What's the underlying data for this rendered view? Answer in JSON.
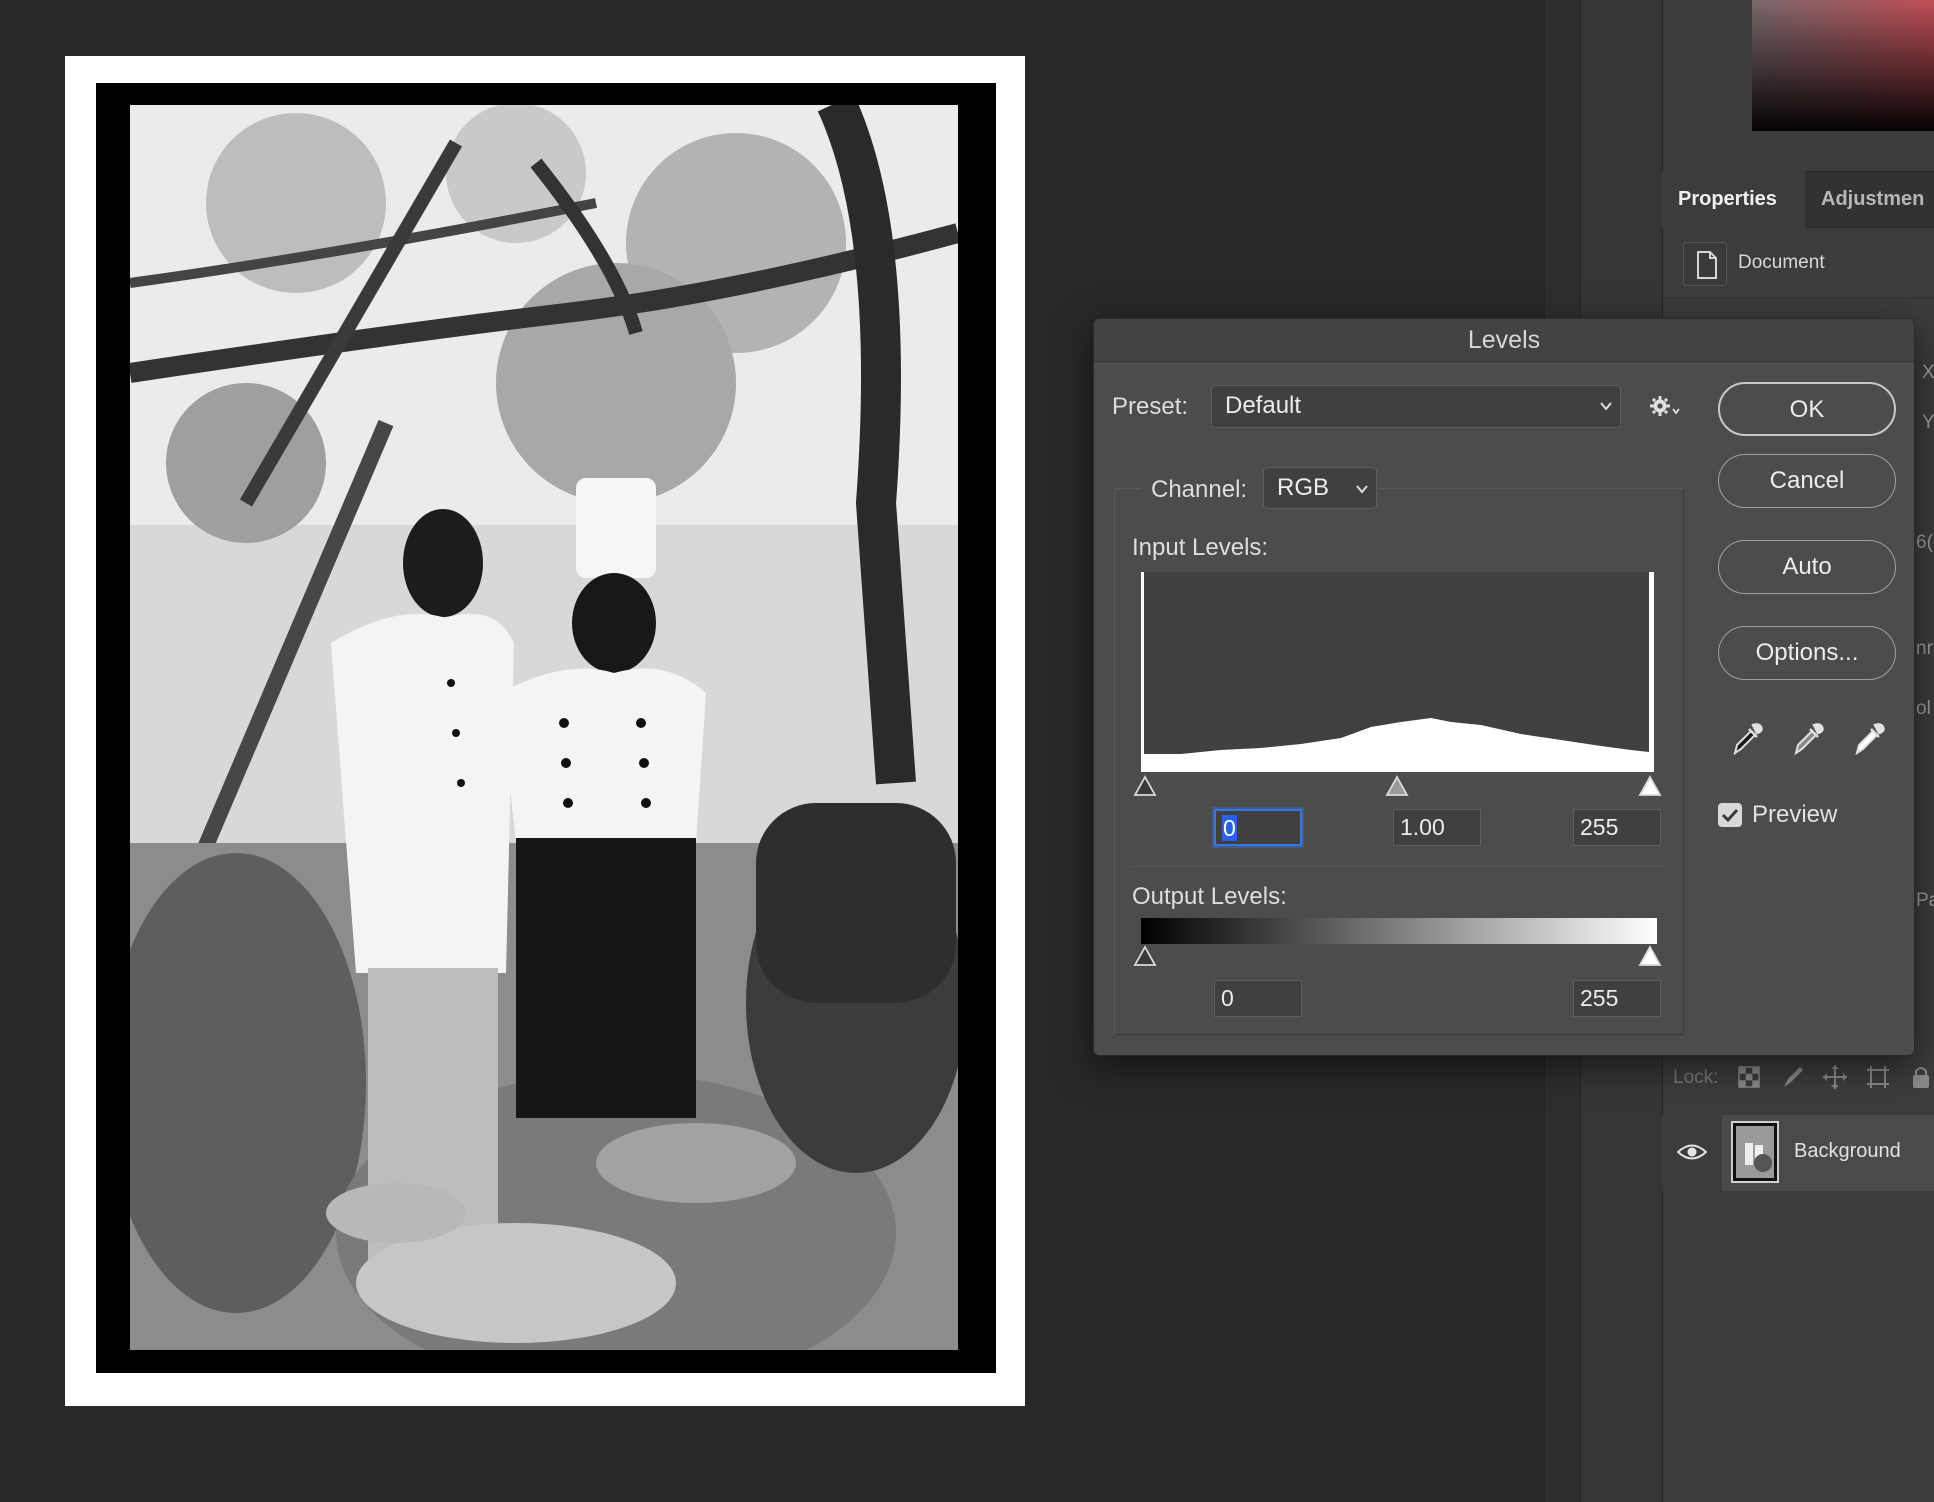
{
  "dialog": {
    "title": "Levels",
    "preset_label": "Preset:",
    "preset_value": "Default",
    "channel_label": "Channel:",
    "channel_value": "RGB",
    "input_levels_label": "Input Levels:",
    "output_levels_label": "Output Levels:",
    "input_black": "0",
    "input_gamma": "1.00",
    "input_white": "255",
    "output_black": "0",
    "output_white": "255",
    "buttons": {
      "ok": "OK",
      "cancel": "Cancel",
      "auto": "Auto",
      "options": "Options..."
    },
    "preview_label": "Preview",
    "preview_checked": true,
    "eyedroppers": [
      "black-point-eyedropper-icon",
      "gray-point-eyedropper-icon",
      "white-point-eyedropper-icon"
    ]
  },
  "panel": {
    "tabs": [
      "Properties",
      "Adjustments"
    ],
    "tab_visible_text": [
      "Properties",
      "Adjustmen"
    ],
    "active_tab": "Properties",
    "document_label": "Document",
    "lock_label": "Lock:",
    "layer_name": "Background",
    "edge_glyphs": [
      "X",
      "Y",
      "6(",
      "nr",
      "ol",
      "Pa"
    ]
  },
  "colors": {
    "canvas_bg": "#282828",
    "dialog_bg": "#4c4c4c",
    "panel_bg": "#3c3c3c",
    "focus_blue": "#3477f5"
  }
}
